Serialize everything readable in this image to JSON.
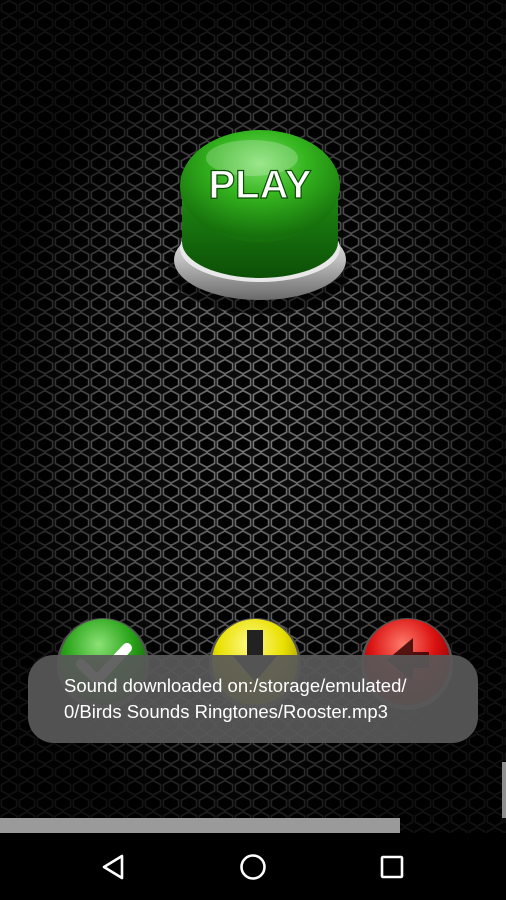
{
  "app": {
    "play_button": {
      "label": "PLAY",
      "color": "#2fa81f"
    },
    "action_buttons": [
      {
        "name": "accept-check-icon",
        "color": "#27a31a"
      },
      {
        "name": "download-arrow-icon",
        "color": "#e8e000"
      },
      {
        "name": "share-icon",
        "color": "#d81010"
      }
    ]
  },
  "toast": {
    "line1": "Sound downloaded on:/storage/emulated/",
    "line2": "0/Birds Sounds Ringtones/Rooster.mp3"
  },
  "navbar": {
    "back_icon": "back-triangle-icon",
    "home_icon": "home-circle-icon",
    "recents_icon": "recents-square-icon"
  }
}
